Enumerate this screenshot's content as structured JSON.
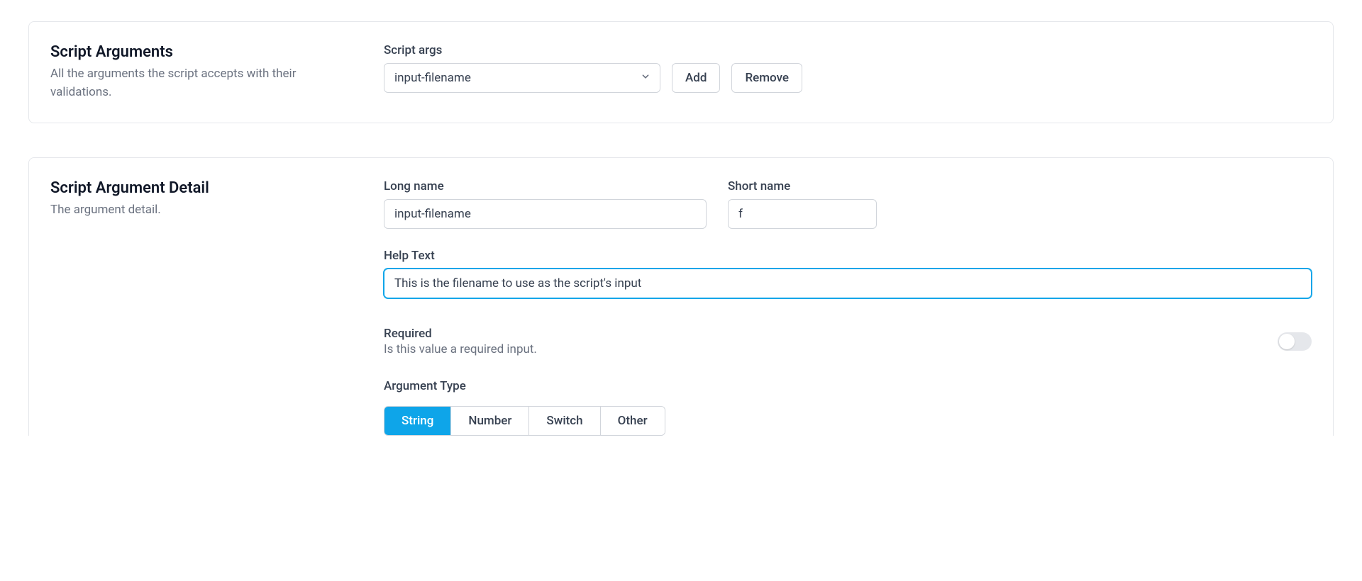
{
  "section1": {
    "title": "Script Arguments",
    "subtitle": "All the arguments the script accepts with their validations.",
    "script_args_label": "Script args",
    "selected_arg": "input-filename",
    "add_button": "Add",
    "remove_button": "Remove"
  },
  "section2": {
    "title": "Script Argument Detail",
    "subtitle": "The argument detail.",
    "long_name_label": "Long name",
    "long_name_value": "input-filename",
    "short_name_label": "Short name",
    "short_name_value": "f",
    "help_text_label": "Help Text",
    "help_text_value": "This is the filename to use as the script's input",
    "required_label": "Required",
    "required_desc": "Is this value a required input.",
    "required_value": false,
    "argument_type_label": "Argument Type",
    "argument_types": {
      "string": "String",
      "number": "Number",
      "switch": "Switch",
      "other": "Other"
    },
    "argument_type_selected": "String"
  }
}
